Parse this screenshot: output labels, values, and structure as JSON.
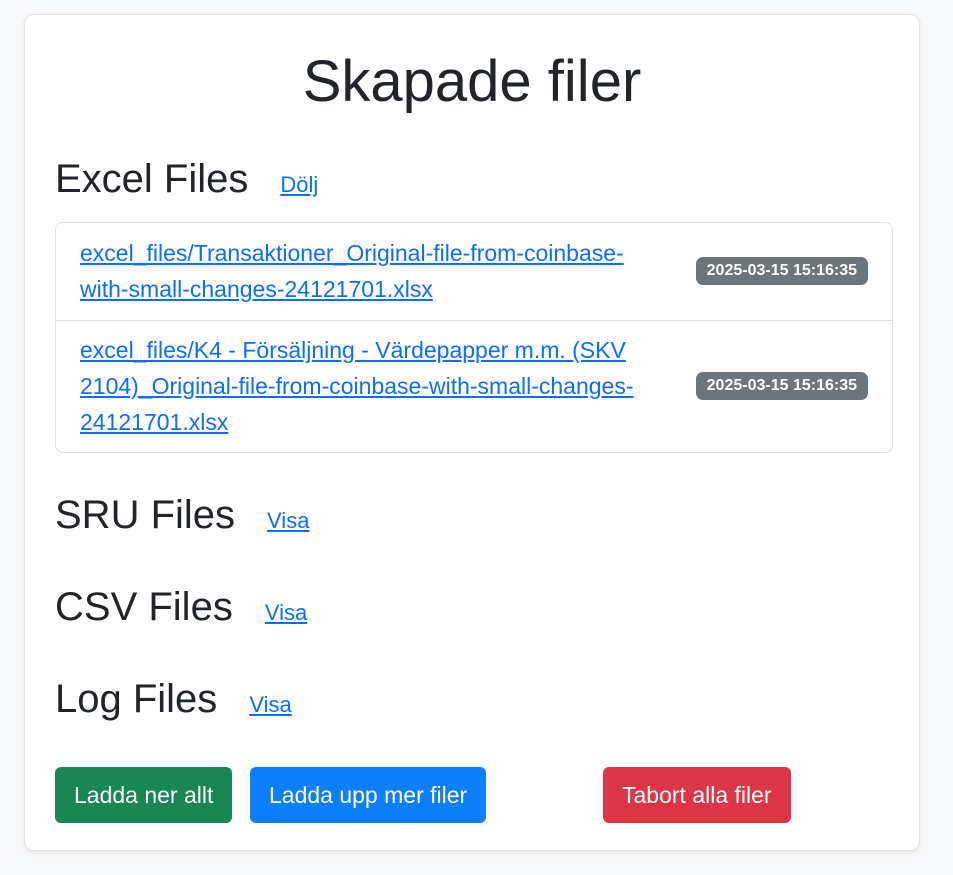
{
  "page": {
    "title": "Skapade filer"
  },
  "sections": {
    "excel": {
      "title": "Excel Files",
      "toggle": "Dölj",
      "files": [
        {
          "name": "excel_files/Transaktioner_Original-file-from-coinbase-with-small-changes-24121701.xlsx",
          "timestamp": "2025-03-15 15:16:35"
        },
        {
          "name": "excel_files/K4 - Försäljning - Värdepapper m.m. (SKV 2104)_Original-file-from-coinbase-with-small-changes-24121701.xlsx",
          "timestamp": "2025-03-15 15:16:35"
        }
      ]
    },
    "sru": {
      "title": "SRU Files",
      "toggle": "Visa"
    },
    "csv": {
      "title": "CSV Files",
      "toggle": "Visa"
    },
    "log": {
      "title": "Log Files",
      "toggle": "Visa"
    }
  },
  "actions": {
    "download_all": "Ladda ner allt",
    "upload_more": "Ladda upp mer filer",
    "delete_all": "Tabort alla filer"
  },
  "colors": {
    "link": "#0d6efd",
    "success": "#198754",
    "primary": "#0d7ffd",
    "danger": "#dc3545",
    "badge": "#6c757d"
  }
}
